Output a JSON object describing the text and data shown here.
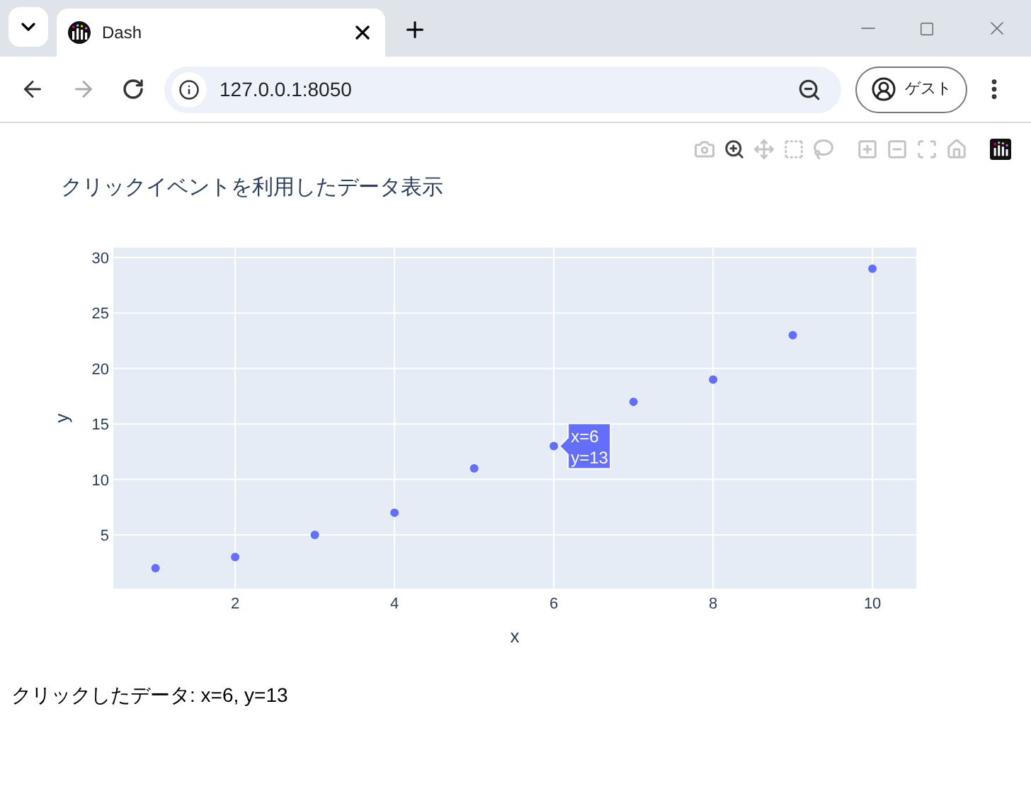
{
  "browser": {
    "tab_title": "Dash",
    "url": "127.0.0.1:8050",
    "profile_label": "ゲスト"
  },
  "modebar": [
    {
      "kind": "camera",
      "selected": false
    },
    {
      "kind": "zoom",
      "selected": true
    },
    {
      "kind": "pan",
      "selected": false
    },
    {
      "kind": "select",
      "selected": false
    },
    {
      "kind": "lasso",
      "selected": false
    },
    {
      "kind": "zoom-in",
      "selected": false
    },
    {
      "kind": "zoom-out",
      "selected": false
    },
    {
      "kind": "autoscale",
      "selected": false
    },
    {
      "kind": "home",
      "selected": false
    },
    {
      "kind": "logo"
    }
  ],
  "chart": {
    "chart_data": {
      "type": "scatter",
      "title": "クリックイベントを利用したデータ表示",
      "xlabel": "x",
      "ylabel": "y",
      "xlim": [
        0.47,
        10.55
      ],
      "ylim": [
        0.15,
        30.9
      ],
      "xticks": [
        2,
        4,
        6,
        8,
        10
      ],
      "yticks": [
        5,
        10,
        15,
        20,
        25,
        30
      ],
      "grid": true,
      "series": [
        {
          "color": "#636efa",
          "x": [
            1,
            2,
            3,
            4,
            5,
            6,
            7,
            8,
            9,
            10
          ],
          "values": [
            2,
            3,
            5,
            7,
            11,
            13,
            17,
            19,
            23,
            29
          ]
        }
      ]
    },
    "tooltip": {
      "lines": [
        "x=6",
        "y=13"
      ]
    }
  },
  "clicked_text": "クリックしたデータ: x=6, y=13"
}
